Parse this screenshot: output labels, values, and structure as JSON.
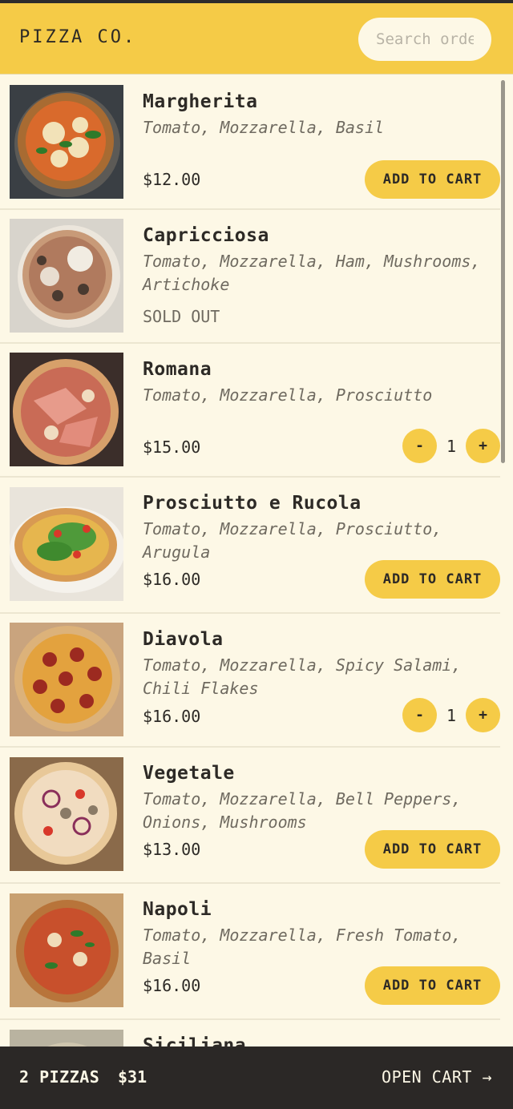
{
  "header": {
    "logo": "PIZZA CO.",
    "search_placeholder": "Search orders"
  },
  "menu": [
    {
      "name": "Margherita",
      "ingredients": "Tomato, Mozzarella, Basil",
      "price": "$12.00",
      "state": "add",
      "button_label": "ADD TO CART",
      "image": "pizza-margherita"
    },
    {
      "name": "Capricciosa",
      "ingredients": "Tomato, Mozzarella, Ham, Mushrooms, Artichoke",
      "price": "",
      "state": "soldout",
      "soldout_label": "SOLD OUT",
      "image": "pizza-capricciosa"
    },
    {
      "name": "Romana",
      "ingredients": "Tomato, Mozzarella, Prosciutto",
      "price": "$15.00",
      "state": "qty",
      "quantity": "1",
      "minus": "-",
      "plus": "+",
      "image": "pizza-romana"
    },
    {
      "name": "Prosciutto e Rucola",
      "ingredients": "Tomato, Mozzarella, Prosciutto, Arugula",
      "price": "$16.00",
      "state": "add",
      "button_label": "ADD TO CART",
      "image": "pizza-prosciutto-rucola"
    },
    {
      "name": "Diavola",
      "ingredients": "Tomato, Mozzarella, Spicy Salami, Chili Flakes",
      "price": "$16.00",
      "state": "qty",
      "quantity": "1",
      "minus": "-",
      "plus": "+",
      "image": "pizza-diavola"
    },
    {
      "name": "Vegetale",
      "ingredients": "Tomato, Mozzarella, Bell Peppers, Onions, Mushrooms",
      "price": "$13.00",
      "state": "add",
      "button_label": "ADD TO CART",
      "image": "pizza-vegetale"
    },
    {
      "name": "Napoli",
      "ingredients": "Tomato, Mozzarella, Fresh Tomato, Basil",
      "price": "$16.00",
      "state": "add",
      "button_label": "ADD TO CART",
      "image": "pizza-napoli"
    },
    {
      "name": "Siciliana",
      "image": "pizza-siciliana"
    }
  ],
  "footer": {
    "count": "2 PIZZAS",
    "total": "$31",
    "open_cart": "OPEN CART →"
  }
}
